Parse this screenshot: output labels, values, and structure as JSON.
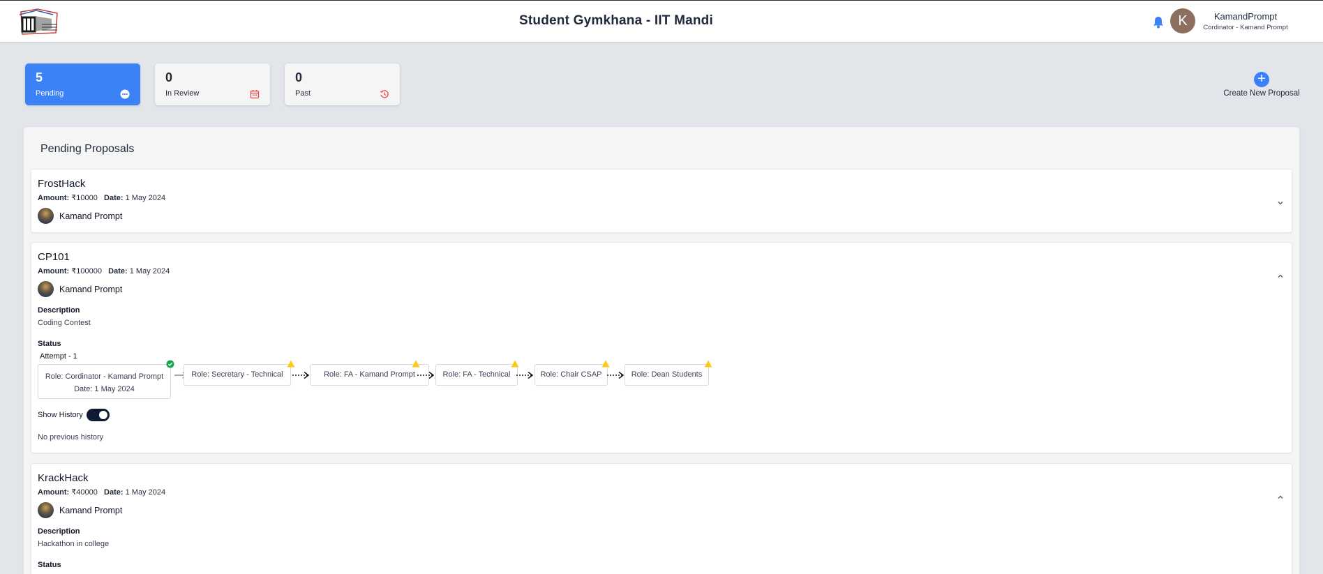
{
  "header": {
    "title": "Student Gymkhana - IIT Mandi",
    "avatar_initial": "K",
    "user_name": "KamandPrompt",
    "user_role": "Cordinator - Kamand Prompt"
  },
  "stats": [
    {
      "count": "5",
      "label": "Pending",
      "icon": "more-horizontal-icon"
    },
    {
      "count": "0",
      "label": "In Review",
      "icon": "calendar-icon"
    },
    {
      "count": "0",
      "label": "Past",
      "icon": "history-icon"
    }
  ],
  "create_label": "Create New Proposal",
  "panel_title": "Pending Proposals",
  "labels": {
    "amount": "Amount:",
    "date": "Date:",
    "description": "Description",
    "status": "Status",
    "show_history": "Show History"
  },
  "proposals": [
    {
      "title": "FrostHack",
      "amount": "₹10000",
      "date": "1 May 2024",
      "owner": "Kamand Prompt",
      "expanded": false
    },
    {
      "title": "CP101",
      "amount": "₹100000",
      "date": "1 May 2024",
      "owner": "Kamand Prompt",
      "expanded": true,
      "description": "Coding Contest",
      "attempt": "Attempt - 1",
      "steps": [
        {
          "role": "Role: Cordinator - Kamand Prompt",
          "date": "Date: 1 May 2024",
          "state": "approved"
        },
        {
          "role": "Role: Secretary - Technical",
          "state": "pending"
        },
        {
          "role": "Role: FA - Kamand Prompt",
          "state": "pending"
        },
        {
          "role": "Role: FA - Technical",
          "state": "pending"
        },
        {
          "role": "Role: Chair CSAP",
          "state": "pending"
        },
        {
          "role": "Role: Dean Students",
          "state": "pending"
        }
      ],
      "history_text": "No previous history"
    },
    {
      "title": "KrackHack",
      "amount": "₹40000",
      "date": "1 May 2024",
      "owner": "Kamand Prompt",
      "expanded": true,
      "description": "Hackathon in college"
    }
  ],
  "colors": {
    "accent": "#3b82f6",
    "warning": "#facc15",
    "success": "#16a34a",
    "toggle": "#0f1b33"
  }
}
